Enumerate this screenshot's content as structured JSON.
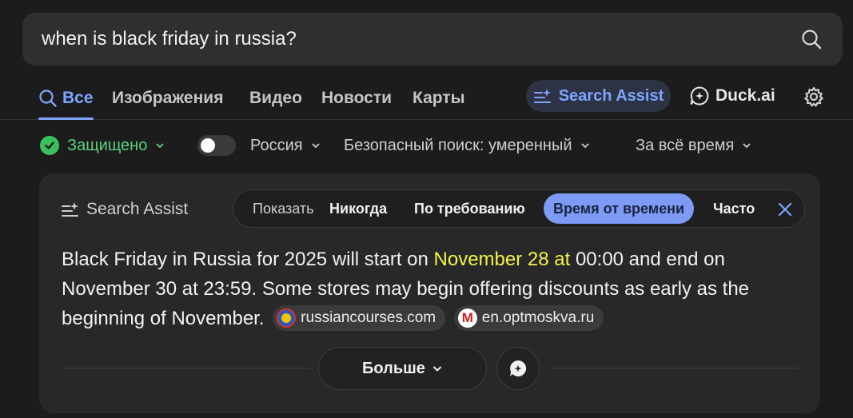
{
  "search": {
    "query": "when is black friday in russia?"
  },
  "nav": {
    "tabs": [
      {
        "label": "Все",
        "active": true
      },
      {
        "label": "Изображения"
      },
      {
        "label": "Видео"
      },
      {
        "label": "Новости"
      },
      {
        "label": "Карты"
      }
    ],
    "search_assist": "Search Assist",
    "duck_ai": "Duck.ai"
  },
  "filters": {
    "protected": "Защищено",
    "region": "Россия",
    "safe_search": "Безопасный поиск: умеренный",
    "time": "За всё время"
  },
  "assist_card": {
    "title": "Search Assist",
    "show_label": "Показать",
    "options": [
      "Никогда",
      "По требованию",
      "Время от времени",
      "Часто"
    ],
    "selected_option": "Время от времени",
    "answer": {
      "before": "Black Friday in Russia for 2025 will start on ",
      "highlight": "November 28 at",
      "after": " 00:00 and end on November 30 at 23:59. Some stores may begin offering discounts as early as the beginning of November."
    },
    "sources": [
      {
        "name": "russiancourses.com"
      },
      {
        "name": "en.optmoskva.ru",
        "favicon_letter": "M"
      }
    ],
    "more_label": "Больше"
  },
  "colors": {
    "accent": "#7ea5ff",
    "protected_green": "#5bd37a",
    "highlight": "#f3f34a"
  },
  "icons": [
    "search-icon",
    "sparkle-icon",
    "chat-icon",
    "gear-icon",
    "check-icon",
    "chevron-down-icon",
    "close-icon",
    "message-icon"
  ]
}
